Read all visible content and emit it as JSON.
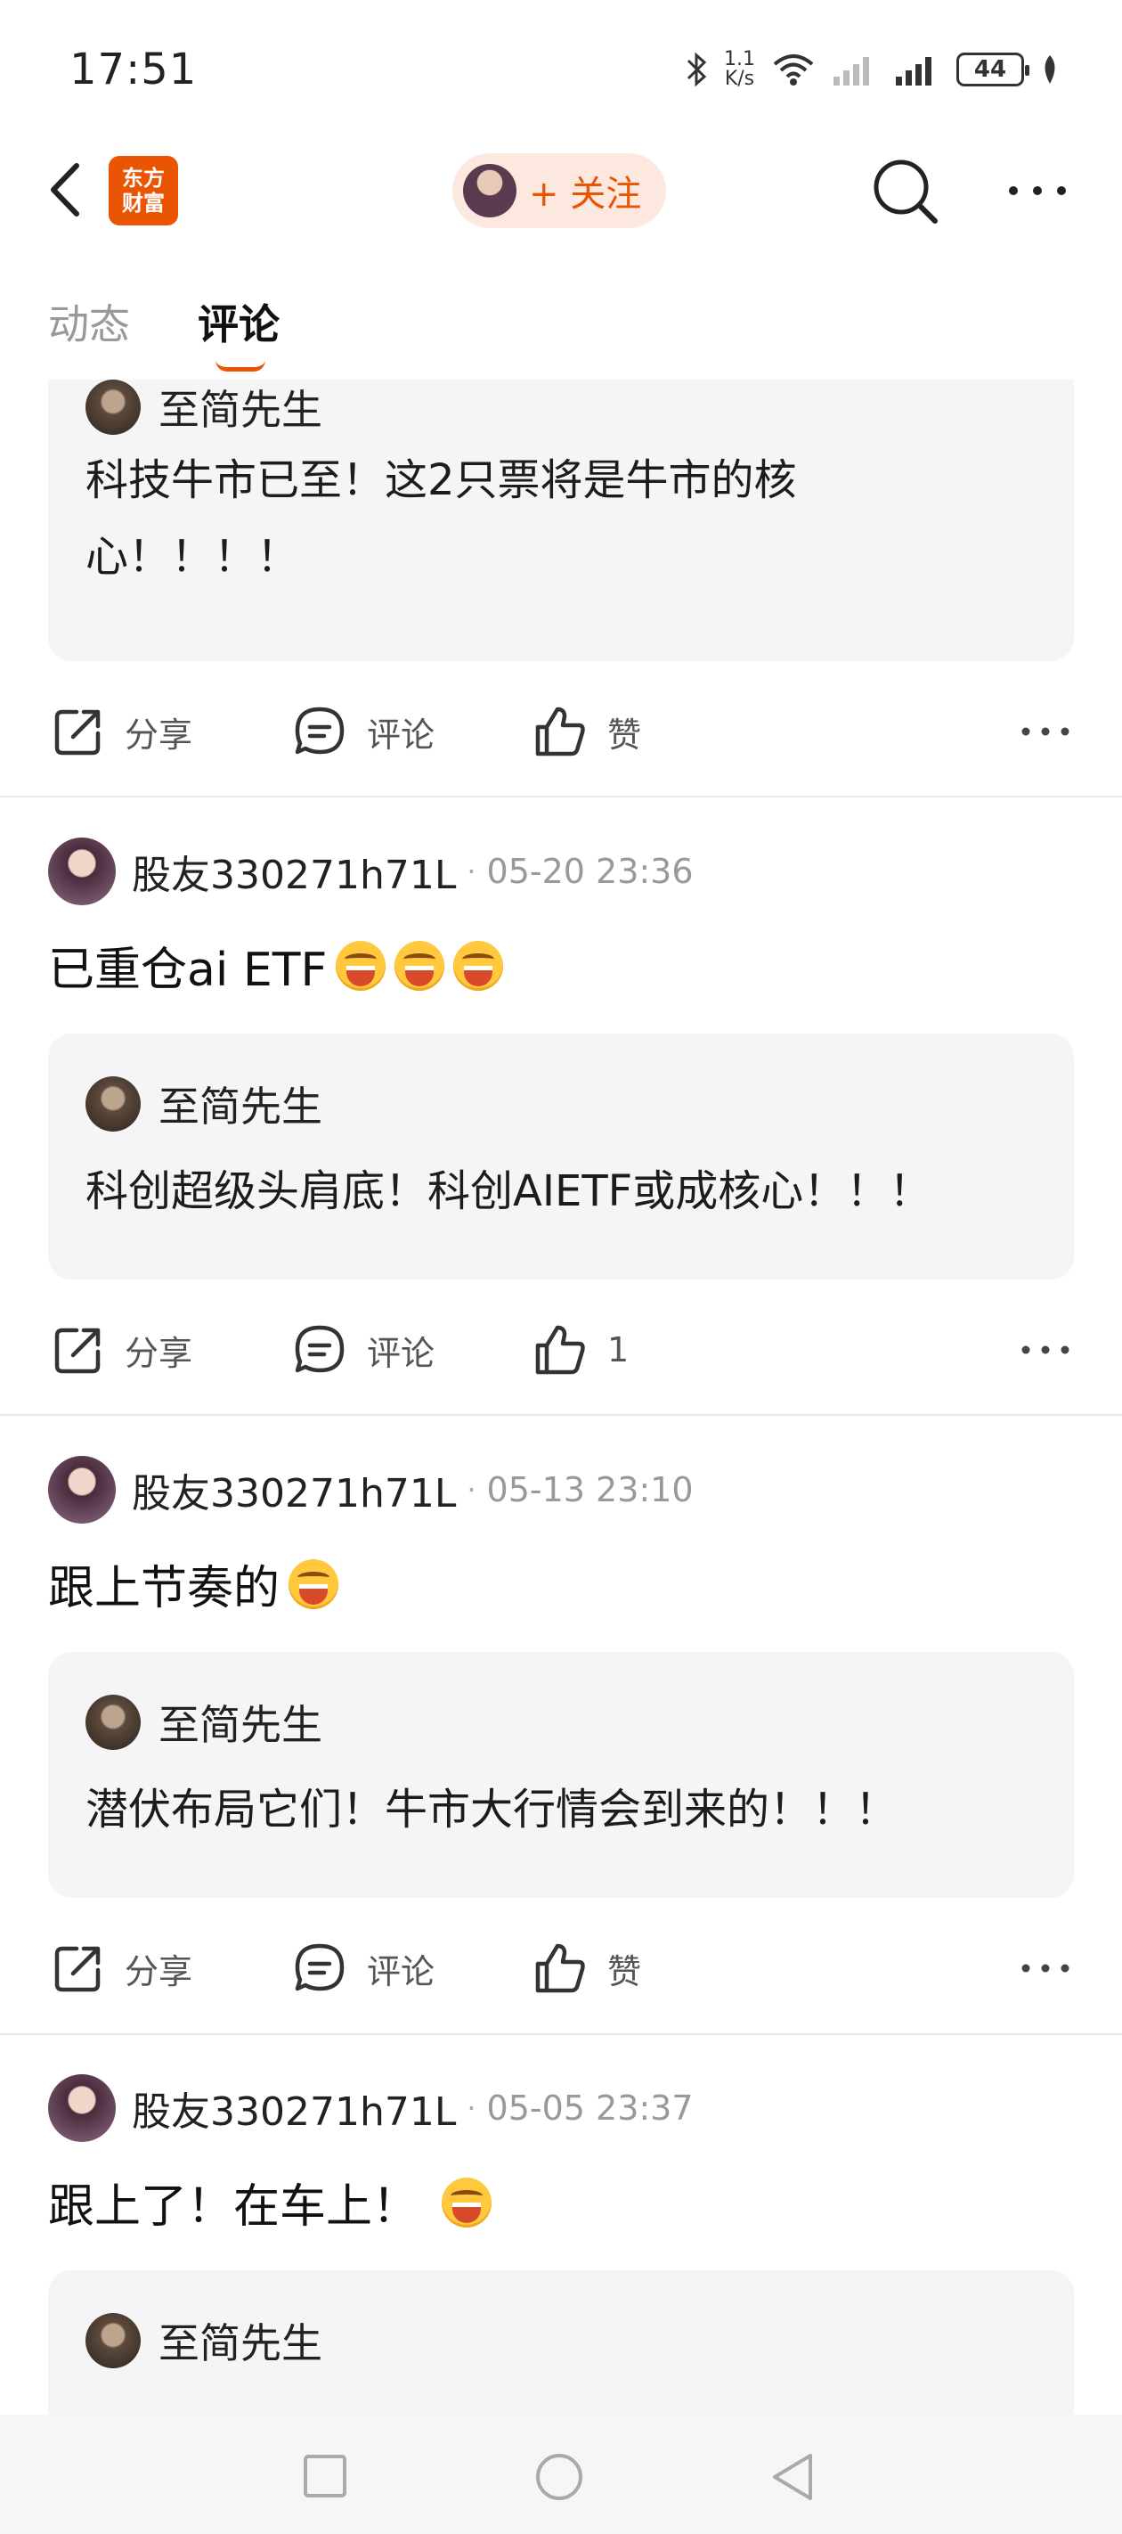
{
  "status_bar": {
    "time": "17:51",
    "net_speed_value": "1.1",
    "net_speed_unit": "K/s",
    "battery": "44"
  },
  "nav": {
    "logo_line1": "东方",
    "logo_line2": "财富",
    "follow_label": "+ 关注"
  },
  "tabs": {
    "dynamic": "动态",
    "comment": "评论"
  },
  "actions": {
    "share": "分享",
    "comment": "评论",
    "like": "赞"
  },
  "posts": [
    {
      "quote_author": "至简先生",
      "quote_line1": "科技牛市已至！这2只票将是牛市的核",
      "quote_line2": "心！！！！",
      "likes": "赞"
    },
    {
      "user": "股友330271h71L",
      "date": "05-20 23:36",
      "text": "已重仓ai ETF",
      "quote_author": "至简先生",
      "quote_text": "科创超级头肩底！科创AIETF或成核心！！！",
      "likes": "1"
    },
    {
      "user": "股友330271h71L",
      "date": "05-13 23:10",
      "text": "跟上节奏的",
      "quote_author": "至简先生",
      "quote_text": "潜伏布局它们！牛市大行情会到来的！！！",
      "likes": "赞"
    },
    {
      "user": "股友330271h71L",
      "date": "05-05 23:37",
      "text": "跟上了！在车上！",
      "quote_author": "至简先生"
    }
  ],
  "colors": {
    "accent": "#ea5504",
    "quote_bg": "#f5f5f7",
    "muted": "#999999"
  },
  "icons": [
    "back-arrow-icon",
    "search-icon",
    "more-dots-icon",
    "share-icon",
    "comment-icon",
    "like-thumb-icon",
    "laughing-emoji-icon",
    "bluetooth-icon",
    "wifi-icon",
    "signal-icon",
    "battery-icon",
    "nav-square-icon",
    "nav-circle-icon",
    "nav-triangle-icon"
  ]
}
